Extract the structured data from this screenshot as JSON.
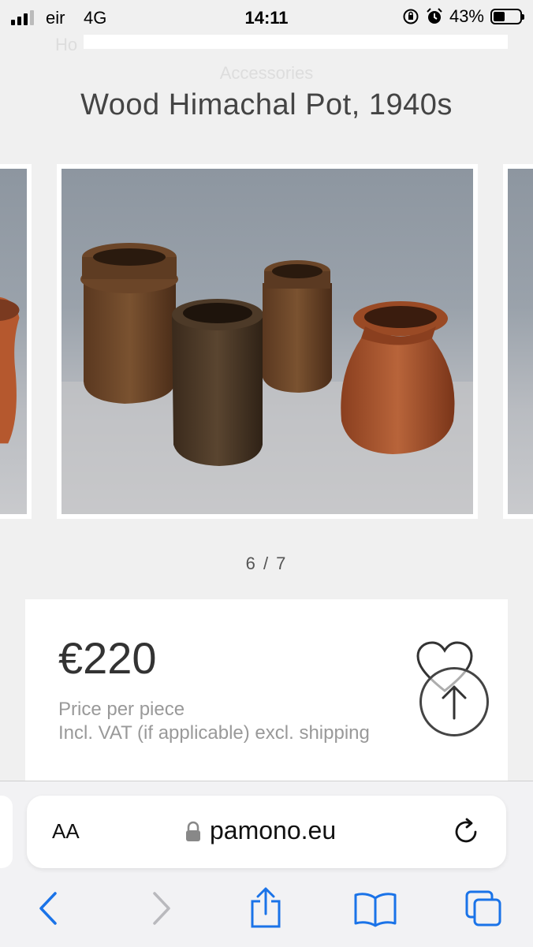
{
  "status_bar": {
    "carrier": "eir",
    "network": "4G",
    "time": "14:11",
    "battery": "43%"
  },
  "page": {
    "faded_nav": "Ho",
    "faded_subnav": "Accessories",
    "title": "Wood Himachal Pot, 1940s",
    "gallery_counter": "6 / 7",
    "price": "€220",
    "price_note": "Price per piece",
    "vat_note": "Incl. VAT (if applicable) excl. shipping"
  },
  "browser": {
    "text_size_label": "AA",
    "domain": "pamono.eu"
  },
  "icons": [
    "signal-icon",
    "battery-icon",
    "heart-icon",
    "scroll-top-icon",
    "lock-icon",
    "reload-icon",
    "back-icon",
    "forward-icon",
    "share-icon",
    "bookmarks-icon",
    "tabs-icon"
  ]
}
